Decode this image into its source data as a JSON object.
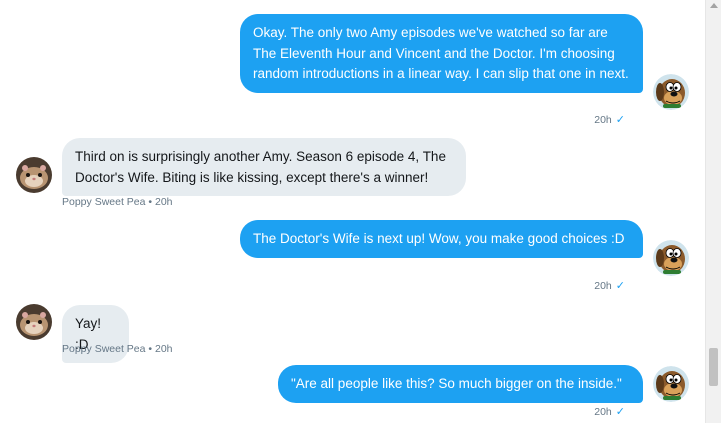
{
  "conversation": {
    "messages": [
      {
        "direction": "sent",
        "text": "Okay. The only two Amy episodes we've watched so far are The Eleventh Hour and Vincent and the Doctor. I'm choosing random introductions in a linear way. I can slip that one in next.",
        "time": "20h"
      },
      {
        "direction": "received",
        "text": "Third on is surprisingly another Amy. Season 6 episode 4, The Doctor's Wife. Biting is like kissing, except there's a winner!",
        "sender_time": "Poppy Sweet Pea • 20h"
      },
      {
        "direction": "sent",
        "text": "The Doctor's Wife is next up! Wow, you make good choices :D",
        "time": "20h"
      },
      {
        "direction": "received",
        "text": "Yay! :D",
        "sender_time": "Poppy Sweet Pea • 20h"
      },
      {
        "direction": "sent",
        "text": "\"Are all people like this? So much bigger on the inside.\"",
        "time": "20h"
      }
    ]
  },
  "icons": {
    "read_receipt": "check-icon",
    "self_avatar": "cartoon-dog-avatar",
    "other_avatar": "hamster-photo-avatar"
  },
  "colors": {
    "sent_bubble": "#1da1f2",
    "received_bubble": "#e6ecf0",
    "meta_text": "#657786"
  }
}
